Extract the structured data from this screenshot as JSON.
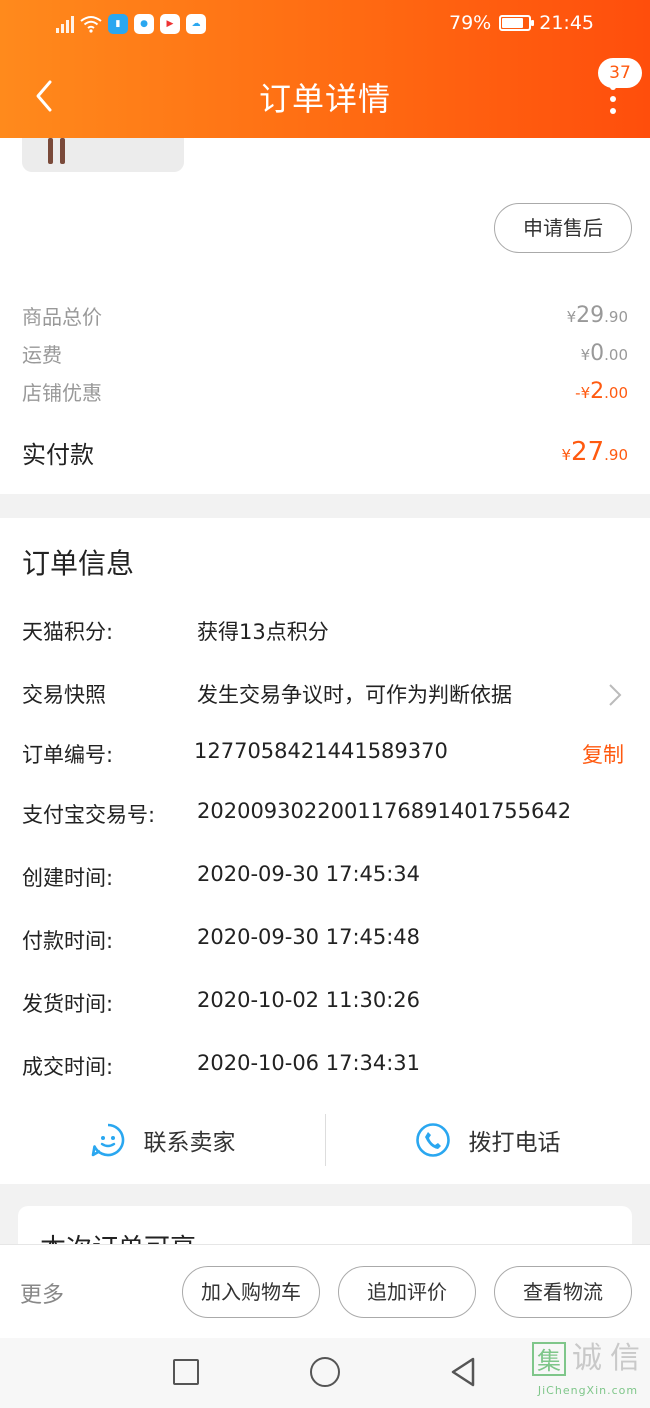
{
  "status_bar": {
    "battery_percent": "79%",
    "battery_level": 0.79,
    "time": "21:45",
    "app_icons": [
      "hd-signal-icon",
      "wifi-icon",
      "reader-app-icon",
      "bulb-app-icon",
      "youku-app-icon",
      "cloud-app-icon"
    ]
  },
  "header": {
    "title": "订单详情",
    "message_count": "37"
  },
  "product": {
    "after_sale_button": "申请售后"
  },
  "prices": {
    "goods_total": {
      "label": "商品总价",
      "currency": "¥",
      "int": "29",
      "dec": ".90"
    },
    "shipping": {
      "label": "运费",
      "currency": "¥",
      "int": "0",
      "dec": ".00"
    },
    "store_discount": {
      "label": "店铺优惠",
      "currency": "-¥",
      "int": "2",
      "dec": ".00"
    },
    "paid": {
      "label": "实付款",
      "currency": "¥",
      "int": "27",
      "dec": ".90"
    }
  },
  "order_info": {
    "title": "订单信息",
    "rows": [
      {
        "key": "天猫积分:",
        "value": "获得13点积分"
      },
      {
        "key": "交易快照",
        "value": "发生交易争议时，可作为判断依据"
      },
      {
        "key": "订单编号:",
        "value": "1277058421441589370",
        "action": "复制"
      },
      {
        "key": "支付宝交易号:",
        "value": "2020093022001176891401755642"
      },
      {
        "key": "创建时间:",
        "value": "2020-09-30 17:45:34"
      },
      {
        "key": "付款时间:",
        "value": "2020-09-30 17:45:48"
      },
      {
        "key": "发货时间:",
        "value": "2020-10-02 11:30:26"
      },
      {
        "key": "成交时间:",
        "value": "2020-10-06 17:34:31"
      }
    ],
    "contact_seller": "联系卖家",
    "call_phone": "拨打电话"
  },
  "recommend": {
    "title": "本次订单可享"
  },
  "action_bar": {
    "more": "更多",
    "add_to_cart": "加入购物车",
    "add_review": "追加评价",
    "view_logistics": "查看物流"
  },
  "watermark": {
    "chars": [
      "集",
      "诚",
      "信"
    ],
    "domain": "JiChengXin.com"
  },
  "colors": {
    "accent": "#ff5a10",
    "header_gradient_start": "#ff8a1c",
    "header_gradient_end": "#ff4e0c",
    "icon_blue": "#2aa7f0"
  }
}
